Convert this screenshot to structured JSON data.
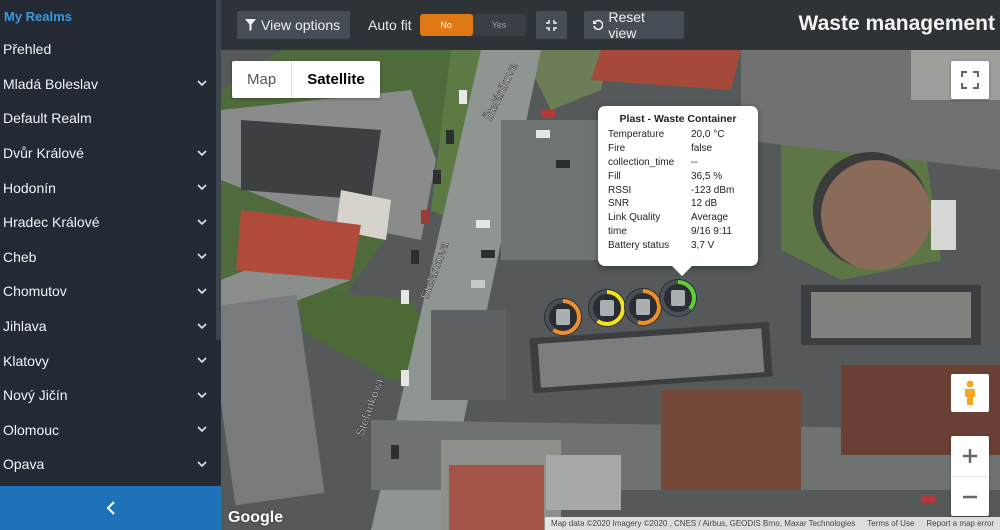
{
  "sidebar": {
    "heading": "My Realms",
    "items": [
      {
        "label": "Přehled",
        "expandable": false
      },
      {
        "label": "Mladá Boleslav",
        "expandable": true
      },
      {
        "label": "Default Realm",
        "expandable": false
      },
      {
        "label": "Dvůr Králové",
        "expandable": true
      },
      {
        "label": "Hodonín",
        "expandable": true
      },
      {
        "label": "Hradec Králové",
        "expandable": true
      },
      {
        "label": "Cheb",
        "expandable": true
      },
      {
        "label": "Chomutov",
        "expandable": true
      },
      {
        "label": "Jihlava",
        "expandable": true
      },
      {
        "label": "Klatovy",
        "expandable": true
      },
      {
        "label": "Nový Jičín",
        "expandable": true
      },
      {
        "label": "Olomouc",
        "expandable": true
      },
      {
        "label": "Opava",
        "expandable": true
      }
    ],
    "collapse_icon": "chevron-left-icon"
  },
  "toolbar": {
    "view_options_label": "View options",
    "autofit_label": "Auto fit",
    "autofit_no": "No",
    "autofit_yes": "Yes",
    "autofit_value": "No",
    "reset_view_label": "Reset view"
  },
  "page_title": "Waste management",
  "map": {
    "type_options": [
      "Map",
      "Satellite"
    ],
    "selected_type": "Satellite",
    "street_labels": [
      "Štefánikova",
      "Štefánkova",
      "Štefánkova"
    ],
    "google_logo": "Google",
    "attribution": [
      "Map data ©2020 Imagery ©2020 , CNES / Airbus, GEODIS Brno, Maxar Technologies",
      "Terms of Use",
      "Report a map error"
    ]
  },
  "info_window": {
    "title": "Plast - Waste Container",
    "rows": [
      {
        "key": "Temperature",
        "value": "20,0 °C"
      },
      {
        "key": "Fire",
        "value": "false"
      },
      {
        "key": "collection_time",
        "value": "--"
      },
      {
        "key": "Fill",
        "value": "36,5 %"
      },
      {
        "key": "RSSI",
        "value": "-123 dBm"
      },
      {
        "key": "SNR",
        "value": "12 dB"
      },
      {
        "key": "Link Quality",
        "value": "Average"
      },
      {
        "key": "time",
        "value": "9/16 9:11"
      },
      {
        "key": "Battery status",
        "value": "3,7 V"
      }
    ]
  },
  "markers": [
    {
      "name": "orange",
      "color": "#f0902a",
      "fill": 0.6
    },
    {
      "name": "yellow",
      "color": "#f2e21d",
      "fill": 0.6
    },
    {
      "name": "orange",
      "color": "#f0902a",
      "fill": 0.55
    },
    {
      "name": "green",
      "color": "#5bd13a",
      "fill": 0.365
    }
  ],
  "colors": {
    "accent": "#1e73b8",
    "toggle_on": "#e07a16",
    "heading": "#3b9ae1"
  }
}
